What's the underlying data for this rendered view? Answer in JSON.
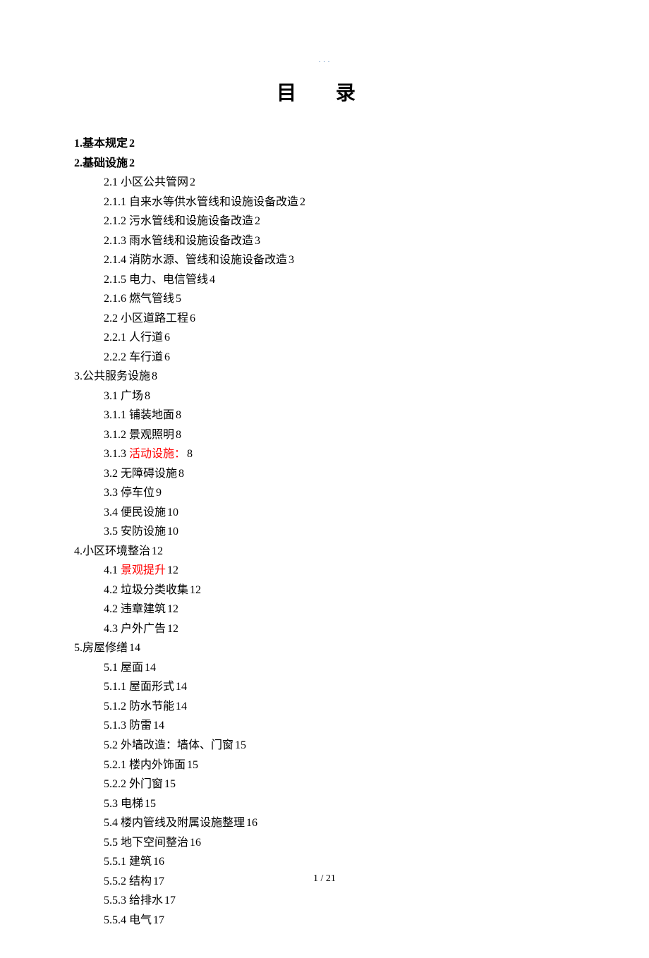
{
  "header_mark": ". . .",
  "title": "目 录",
  "footer": "1 / 21",
  "entries": [
    {
      "level": 1,
      "bold": true,
      "prefix": "1.",
      "text": "基本规定",
      "page": "2"
    },
    {
      "level": 1,
      "bold": true,
      "prefix": "2.",
      "text": "基础设施",
      "page": "2"
    },
    {
      "level": 2,
      "prefix": "2.1 ",
      "text": "小区公共管网",
      "page": "2"
    },
    {
      "level": 3,
      "prefix": "2.1.1 ",
      "text": "自来水等供水管线和设施设备改造",
      "page": "2"
    },
    {
      "level": 3,
      "prefix": "2.1.2 ",
      "text": "污水管线和设施设备改造",
      "page": "2"
    },
    {
      "level": 3,
      "prefix": "2.1.3 ",
      "text": "雨水管线和设施设备改造",
      "page": "3"
    },
    {
      "level": 3,
      "prefix": "2.1.4 ",
      "text": "消防水源、管线和设施设备改造",
      "page": "3"
    },
    {
      "level": 3,
      "prefix": "2.1.5 ",
      "text": "电力、电信管线",
      "page": "4"
    },
    {
      "level": 3,
      "prefix": "2.1.6 ",
      "text": "燃气管线",
      "page": "5"
    },
    {
      "level": 2,
      "prefix": "2.2 ",
      "text": "小区道路工程",
      "page": "6"
    },
    {
      "level": 3,
      "prefix": "2.2.1 ",
      "text": "人行道",
      "page": "6"
    },
    {
      "level": 3,
      "prefix": "2.2.2 ",
      "text": "车行道",
      "page": "6"
    },
    {
      "level": 1,
      "prefix": "3.",
      "text": "公共服务设施",
      "page": "8"
    },
    {
      "level": 2,
      "prefix": "3.1 ",
      "text": "广场",
      "page": "8"
    },
    {
      "level": 3,
      "prefix": "3.1.1 ",
      "text": "铺装地面",
      "page": "8"
    },
    {
      "level": 3,
      "prefix": "3.1.2 ",
      "text": "景观照明",
      "page": "8"
    },
    {
      "level": 3,
      "prefix": "3.1.3 ",
      "text": "活动设施：",
      "red": true,
      "page": "8"
    },
    {
      "level": 2,
      "prefix": "3.2 ",
      "text": "无障碍设施",
      "page": "8"
    },
    {
      "level": 2,
      "prefix": "3.3 ",
      "text": "停车位",
      "page": "9"
    },
    {
      "level": 2,
      "prefix": "3.4 ",
      "text": "便民设施",
      "page": "10"
    },
    {
      "level": 2,
      "prefix": "3.5 ",
      "text": "安防设施",
      "page": "10"
    },
    {
      "level": 1,
      "prefix": "4.",
      "text": "小区环境整治",
      "page": "12"
    },
    {
      "level": 2,
      "prefix": "4.1 ",
      "text": "景观提升",
      "red": true,
      "page": "12"
    },
    {
      "level": 2,
      "prefix": "4.2 ",
      "text": "垃圾分类收集",
      "page": "12"
    },
    {
      "level": 2,
      "prefix": "4.2 ",
      "text": "违章建筑",
      "page": "12"
    },
    {
      "level": 2,
      "prefix": "4.3 ",
      "text": "户外广告",
      "page": "12"
    },
    {
      "level": 1,
      "prefix": "5.",
      "text": "房屋修缮",
      "page": "14"
    },
    {
      "level": 2,
      "prefix": "5.1 ",
      "text": "屋面",
      "page": "14"
    },
    {
      "level": 3,
      "prefix": "5.1.1 ",
      "text": "屋面形式",
      "page": "14"
    },
    {
      "level": 3,
      "prefix": "5.1.2 ",
      "text": "防水节能",
      "page": "14"
    },
    {
      "level": 3,
      "prefix": "5.1.3 ",
      "text": "防雷",
      "page": "14"
    },
    {
      "level": 2,
      "prefix": "5.2 ",
      "text": "外墙改造：墙体、门窗",
      "page": "15"
    },
    {
      "level": 3,
      "prefix": "5.2.1 ",
      "text": "楼内外饰面",
      "page": "15"
    },
    {
      "level": 3,
      "prefix": "5.2.2 ",
      "text": "外门窗",
      "page": "15"
    },
    {
      "level": 2,
      "prefix": "5.3 ",
      "text": "电梯",
      "page": "15"
    },
    {
      "level": 2,
      "prefix": "5.4 ",
      "text": "楼内管线及附属设施整理",
      "page": "16"
    },
    {
      "level": 2,
      "prefix": "5.5 ",
      "text": "地下空间整治",
      "page": "16"
    },
    {
      "level": 3,
      "prefix": "5.5.1 ",
      "text": "建筑",
      "page": "16"
    },
    {
      "level": 3,
      "prefix": "5.5.2 ",
      "text": "结构",
      "page": "17"
    },
    {
      "level": 3,
      "prefix": "5.5.3 ",
      "text": "给排水",
      "page": "17"
    },
    {
      "level": 3,
      "prefix": "5.5.4 ",
      "text": "电气",
      "page": "17"
    }
  ]
}
